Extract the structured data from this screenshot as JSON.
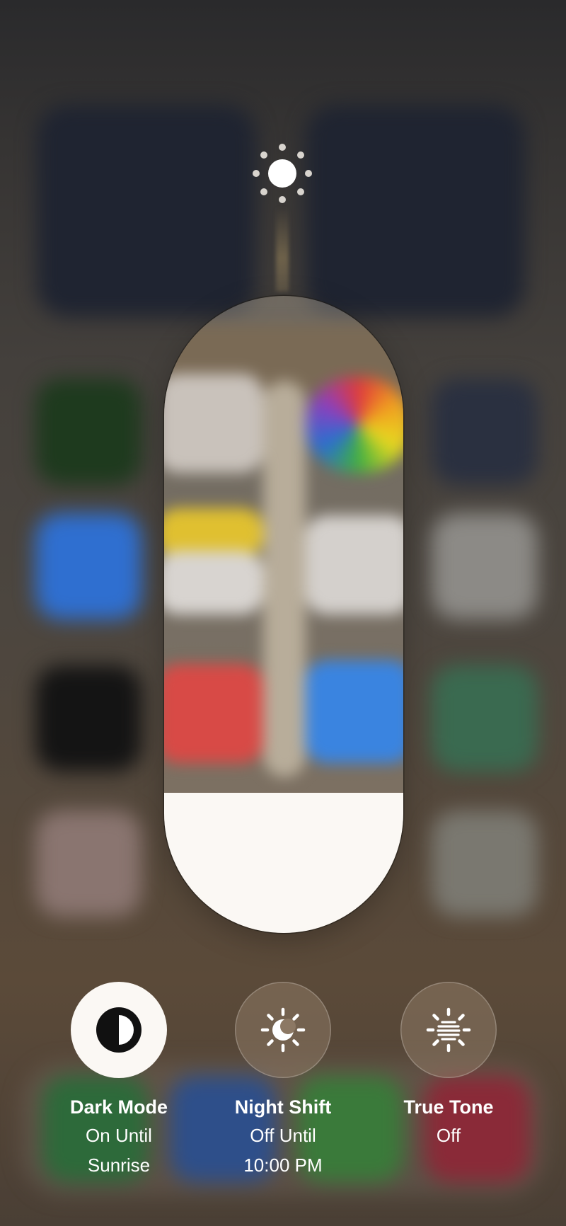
{
  "brightness": {
    "icon": "sun-brightness-icon",
    "level": 0.22
  },
  "controls": [
    {
      "title": "Dark Mode",
      "status_line1": "On Until",
      "status_line2": "Sunrise",
      "icon": "dark-mode-icon",
      "active": true
    },
    {
      "title": "Night Shift",
      "status_line1": "Off Until",
      "status_line2": "10:00 PM",
      "icon": "night-shift-icon",
      "active": false
    },
    {
      "title": "True Tone",
      "status_line1": "Off",
      "status_line2": "",
      "icon": "true-tone-icon",
      "active": false
    }
  ],
  "colors": {
    "active_button": "#fbf8f4",
    "inactive_button": "#8c7864",
    "text": "#ffffff"
  }
}
